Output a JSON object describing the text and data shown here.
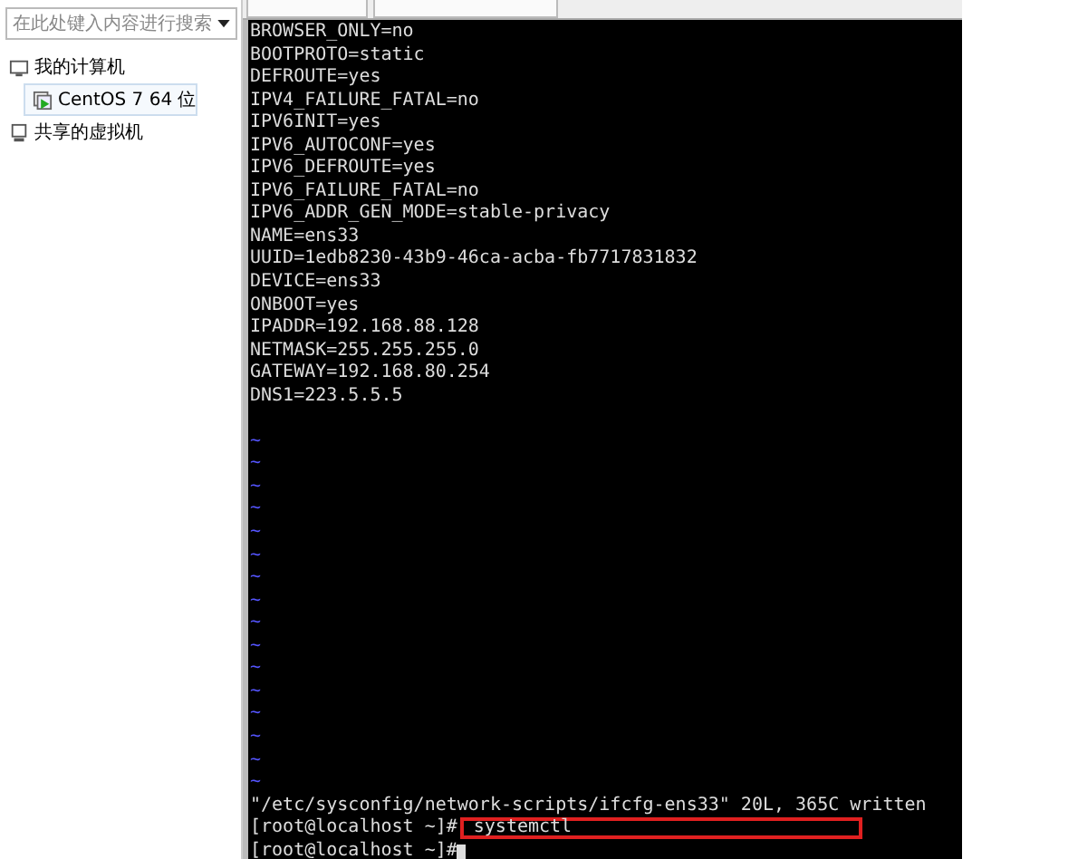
{
  "sidebar": {
    "search": {
      "placeholder": "在此处键入内容进行搜索"
    },
    "tree": [
      {
        "label": "我的计算机",
        "kind": "computer",
        "selected": false,
        "children": [
          {
            "label": "CentOS 7 64 位",
            "kind": "vm",
            "selected": true
          }
        ]
      },
      {
        "label": "共享的虚拟机",
        "kind": "shared",
        "selected": false
      }
    ]
  },
  "terminal": {
    "lines": [
      "BROWSER_ONLY=no",
      "BOOTPROTO=static",
      "DEFROUTE=yes",
      "IPV4_FAILURE_FATAL=no",
      "IPV6INIT=yes",
      "IPV6_AUTOCONF=yes",
      "IPV6_DEFROUTE=yes",
      "IPV6_FAILURE_FATAL=no",
      "IPV6_ADDR_GEN_MODE=stable-privacy",
      "NAME=ens33",
      "UUID=1edb8230-43b9-46ca-acba-fb7717831832",
      "DEVICE=ens33",
      "ONBOOT=yes",
      "IPADDR=192.168.88.128",
      "NETMASK=255.255.255.0",
      "GATEWAY=192.168.80.254",
      "DNS1=223.5.5.5"
    ],
    "tildes": [
      "~",
      "~",
      "~",
      "~",
      "~",
      "~",
      "~",
      "~",
      "~",
      "~",
      "~",
      "~",
      "~",
      "~",
      "~",
      "~"
    ],
    "status": "\"/etc/sysconfig/network-scripts/ifcfg-ens33\" 20L, 365C written",
    "prompts": [
      {
        "prompt": "[root@localhost ~]#",
        "command": "systemctl",
        "highlighted": true
      },
      {
        "prompt": "[root@localhost ~]#"
      }
    ]
  }
}
